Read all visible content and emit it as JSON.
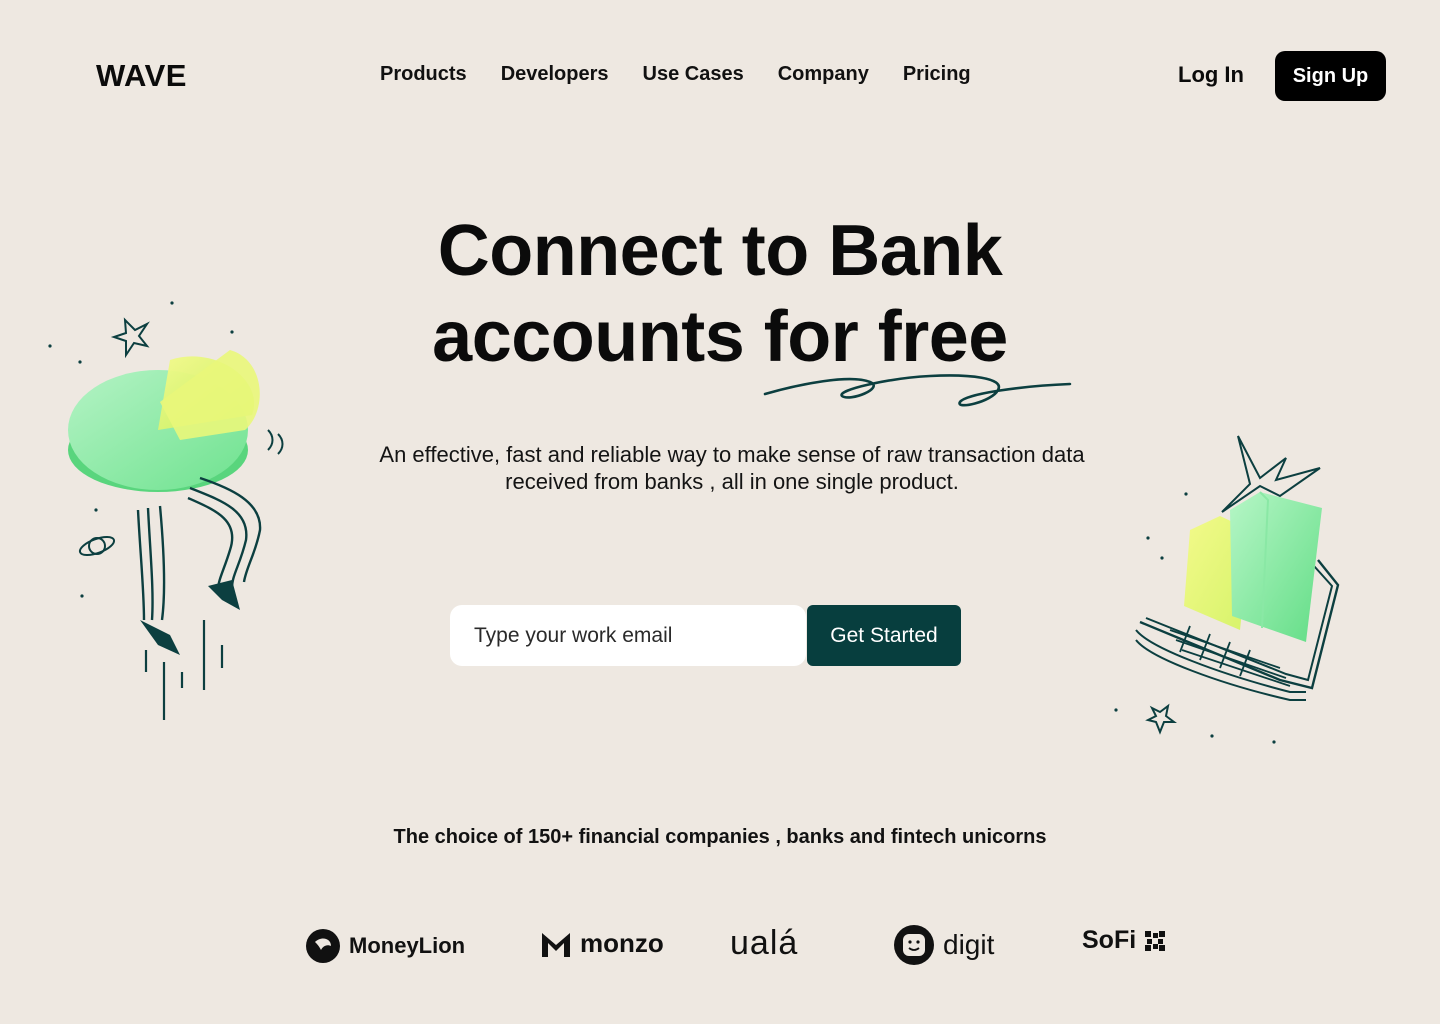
{
  "brand": "WAVE",
  "nav": [
    "Products",
    "Developers",
    "Use Cases",
    "Company",
    "Pricing"
  ],
  "auth": {
    "login": "Log In",
    "signup": "Sign Up"
  },
  "hero": {
    "title_line1": "Connect to Bank",
    "title_line2": "accounts for free",
    "subtitle": "An effective, fast and reliable way to make sense of raw transaction data received from banks , all in one single product."
  },
  "signup_form": {
    "email_placeholder": "Type your work email",
    "email_value": "",
    "cta": "Get Started"
  },
  "trust": {
    "heading": "The choice of 150+ financial companies , banks and fintech unicorns",
    "logos": [
      "MoneyLion",
      "monzo",
      "ualá",
      "digit",
      "SoFi"
    ]
  },
  "colors": {
    "background": "#eee8e1",
    "primary_dark": "#073e3e",
    "signup_bg": "#000000",
    "accent_green": "#7fe39a",
    "accent_yellow": "#e8f56a"
  }
}
